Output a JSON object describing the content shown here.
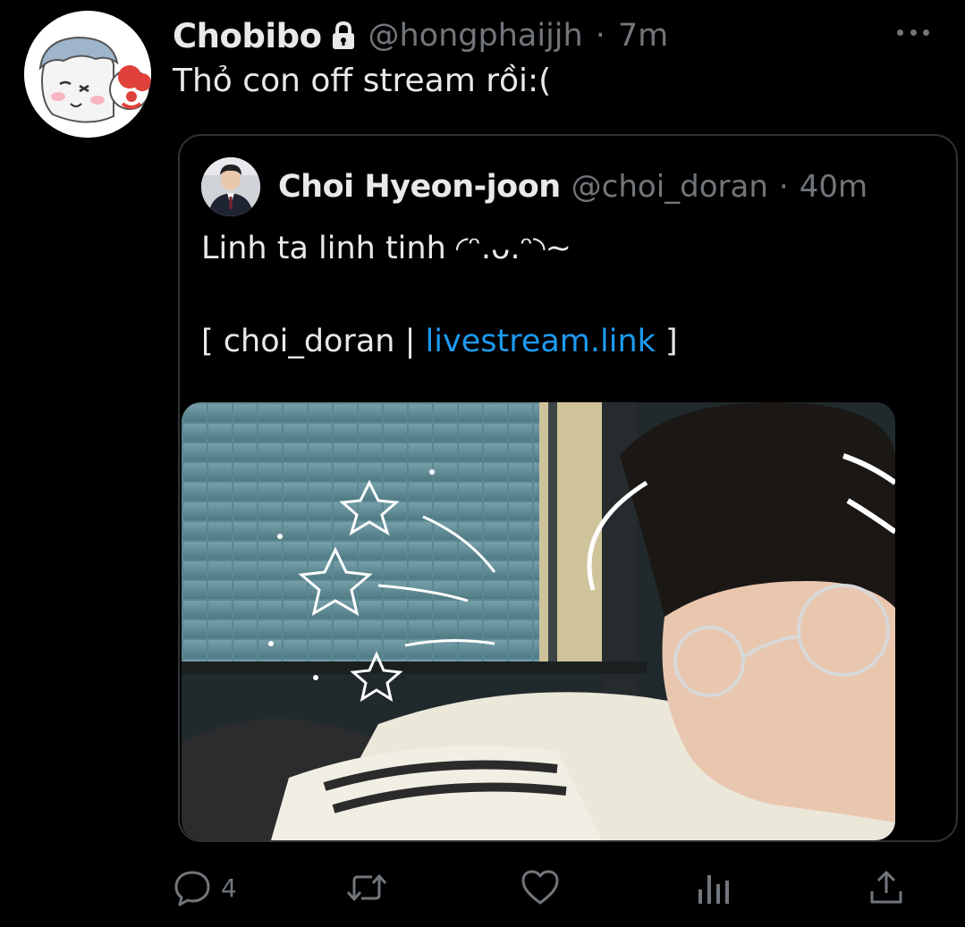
{
  "tweet": {
    "author_name": "Chobibo",
    "author_handle": "@hongphaijjh",
    "separator": "·",
    "time": "7m",
    "text": "Thỏ con off stream rồi:("
  },
  "quoted": {
    "author_name": "Choi Hyeon-joon",
    "author_handle": "@choi_doran",
    "separator": "·",
    "time": "40m",
    "text_line1": "Linh ta linh tinh ◜ᵔ.ᴗ.ᵔ◝~",
    "text_line2_prefix": "[ choi_doran | ",
    "text_line2_link": "livestream.link",
    "text_line2_suffix": " ]"
  },
  "actions": {
    "reply_count": "4"
  },
  "icons": [
    "lock-icon",
    "more-icon",
    "reply-icon",
    "retweet-icon",
    "like-icon",
    "analytics-icon",
    "share-icon"
  ],
  "colors": {
    "background": "#000000",
    "primary_text": "#e7e9ea",
    "secondary_text": "#71767b",
    "link": "#1d9bf0",
    "border": "#2f3336"
  }
}
